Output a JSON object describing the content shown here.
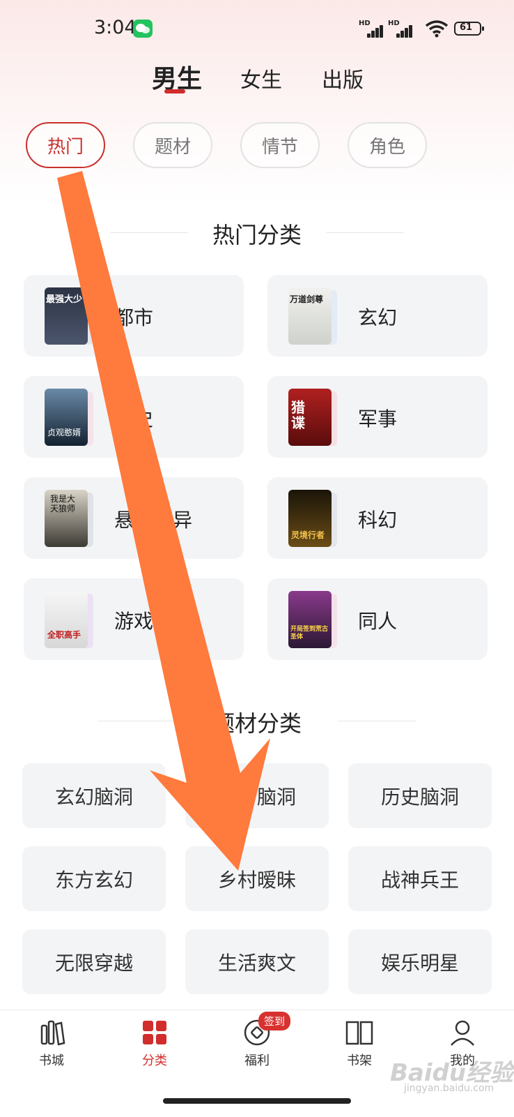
{
  "status_bar": {
    "time": "3:04",
    "signal_1": "HD",
    "signal_2": "HD",
    "battery": "61"
  },
  "gender_tabs": [
    {
      "label": "男生",
      "active": true
    },
    {
      "label": "女生",
      "active": false
    },
    {
      "label": "出版",
      "active": false
    }
  ],
  "filter_pills": [
    {
      "label": "热门",
      "active": true
    },
    {
      "label": "题材",
      "active": false
    },
    {
      "label": "情节",
      "active": false
    },
    {
      "label": "角色",
      "active": false
    }
  ],
  "hot_section": {
    "title": "热门分类",
    "items": [
      {
        "label": "都市",
        "cover_text": "最强大少"
      },
      {
        "label": "玄幻",
        "cover_text": "万道剑尊"
      },
      {
        "label": "历史",
        "cover_text": "贞观憨婿"
      },
      {
        "label": "军事",
        "cover_text": "猎谍"
      },
      {
        "label": "悬疑灵异",
        "cover_text": "我是大天狼师"
      },
      {
        "label": "科幻",
        "cover_text": "灵境行者"
      },
      {
        "label": "游戏竞技",
        "cover_text": "全职高手"
      },
      {
        "label": "同人",
        "cover_text": "开局签到荒古圣体"
      }
    ]
  },
  "topic_section": {
    "title": "题材分类",
    "items": [
      "玄幻脑洞",
      "都市脑洞",
      "历史脑洞",
      "东方玄幻",
      "乡村暧昧",
      "战神兵王",
      "无限穿越",
      "生活爽文",
      "娱乐明星"
    ]
  },
  "bottom_nav": [
    {
      "label": "书城",
      "icon": "books-icon",
      "active": false
    },
    {
      "label": "分类",
      "icon": "grid-icon",
      "active": true
    },
    {
      "label": "福利",
      "icon": "coin-icon",
      "active": false,
      "badge": "签到"
    },
    {
      "label": "书架",
      "icon": "book-open-icon",
      "active": false
    },
    {
      "label": "我的",
      "icon": "person-icon",
      "active": false
    }
  ],
  "watermark": {
    "main": "Baidu经验",
    "sub": "jingyan.baidu.com"
  },
  "colors": {
    "accent": "#d12d2d",
    "arrow": "#ff7a3d",
    "card_bg": "#f3f4f6"
  }
}
